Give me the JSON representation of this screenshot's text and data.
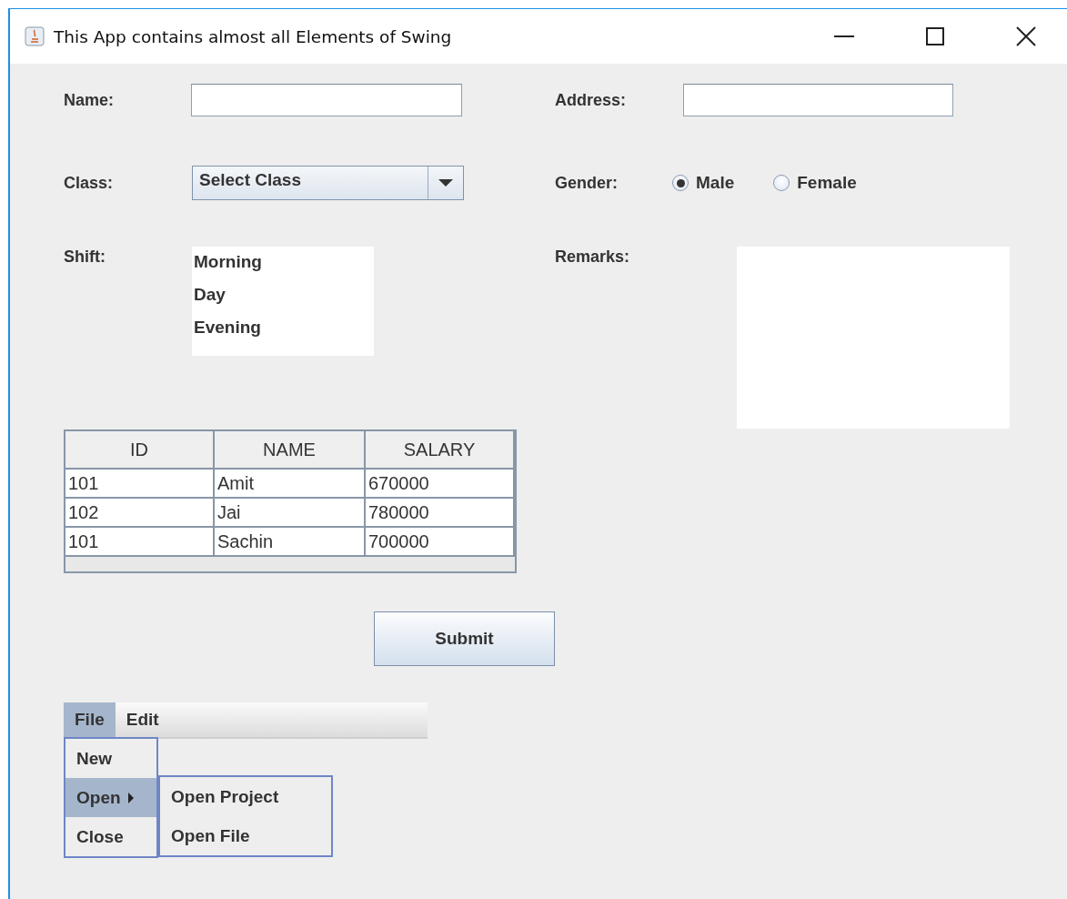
{
  "window": {
    "title": "This App contains almost all Elements of Swing"
  },
  "form": {
    "name": {
      "label": "Name:"
    },
    "address": {
      "label": "Address:"
    },
    "class": {
      "label": "Class:",
      "value": "Select Class"
    },
    "gender": {
      "label": "Gender:",
      "options": [
        {
          "label": "Male",
          "selected": true
        },
        {
          "label": "Female",
          "selected": false
        }
      ]
    },
    "shift": {
      "label": "Shift:",
      "items": [
        "Morning",
        "Day",
        "Evening"
      ]
    },
    "remarks": {
      "label": "Remarks:"
    }
  },
  "table": {
    "columns": [
      "ID",
      "NAME",
      "SALARY"
    ],
    "rows": [
      [
        "101",
        "Amit",
        "670000"
      ],
      [
        "102",
        "Jai",
        "780000"
      ],
      [
        "101",
        "Sachin",
        "700000"
      ]
    ]
  },
  "submit_button": "Submit",
  "menu_bar": {
    "menus": [
      {
        "label": "File",
        "selected": true
      },
      {
        "label": "Edit",
        "selected": false
      }
    ]
  },
  "file_menu": {
    "items": [
      {
        "label": "New",
        "selected": false,
        "has_submenu": false
      },
      {
        "label": "Open",
        "selected": true,
        "has_submenu": true
      },
      {
        "label": "Close",
        "selected": false,
        "has_submenu": false
      }
    ]
  },
  "open_submenu": {
    "items": [
      "Open Project",
      "Open File"
    ]
  }
}
